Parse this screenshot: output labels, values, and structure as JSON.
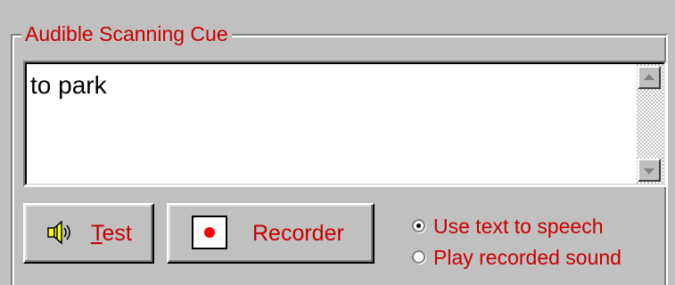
{
  "group": {
    "title": "Audible Scanning Cue"
  },
  "cue_text": {
    "value": "to park"
  },
  "buttons": {
    "test": {
      "accel": "T",
      "rest": "est",
      "icon": "speaker-icon"
    },
    "recorder": {
      "label": "Recorder",
      "icon": "record-icon"
    }
  },
  "options": [
    {
      "label": "Use text to speech",
      "selected": true
    },
    {
      "label": "Play recorded sound",
      "selected": false
    }
  ],
  "colors": {
    "label_red": "#c80000",
    "face": "#c0c0c0",
    "record_dot": "#ff0000"
  }
}
